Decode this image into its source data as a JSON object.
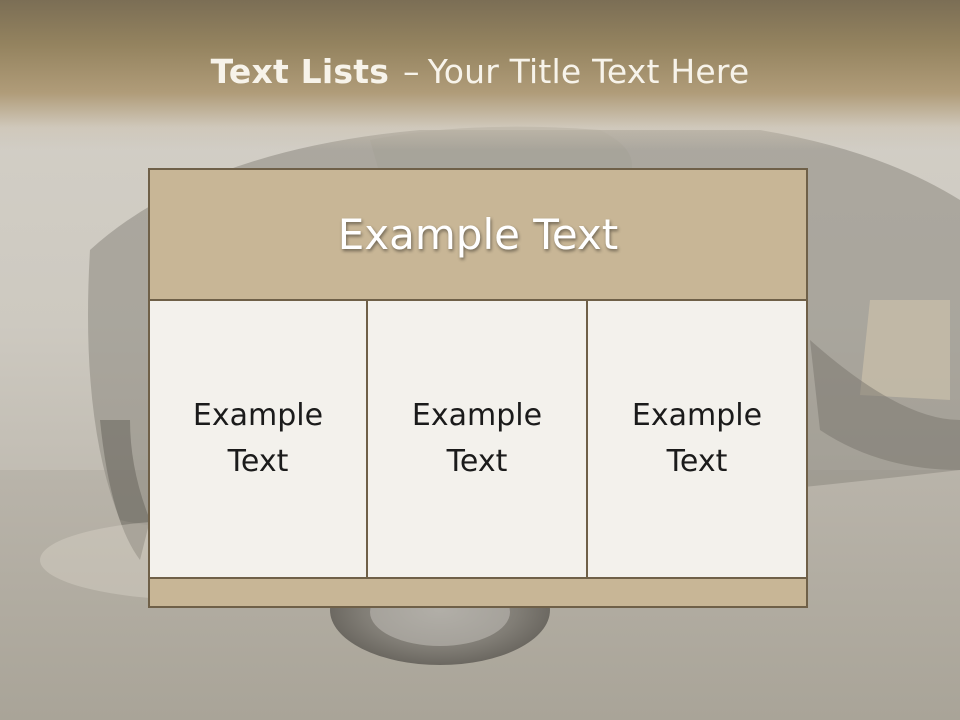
{
  "slide": {
    "title_bold": "Text Lists",
    "title_dash": "–",
    "title_rest": "Your Title Text Here"
  },
  "table": {
    "header": "Example Text",
    "cells": [
      "Example\nText",
      "Example\nText",
      "Example\nText"
    ]
  },
  "colors": {
    "title_band": "#94835f",
    "header_fill": "#c8b696",
    "cell_fill": "#f3f1ec",
    "border": "#6f6048"
  }
}
